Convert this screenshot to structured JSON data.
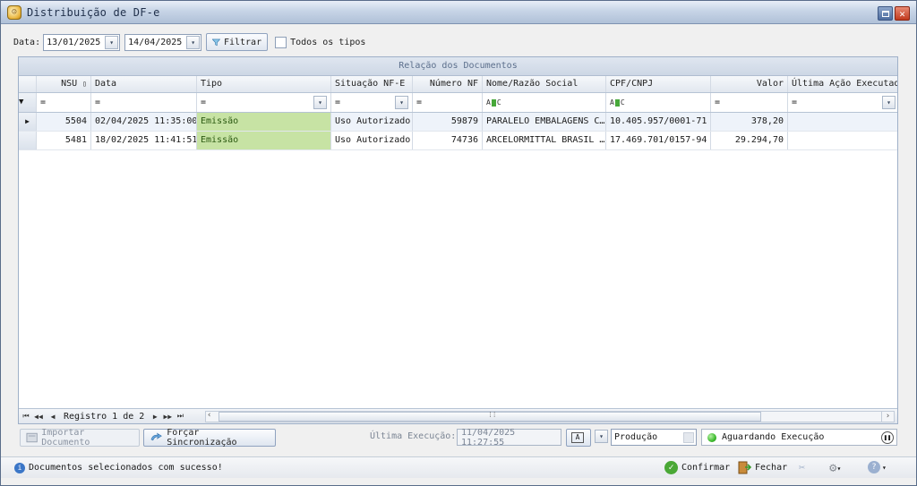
{
  "window": {
    "title": "Distribuição de DF-e"
  },
  "toolbar": {
    "date_label": "Data:",
    "date_from": "13/01/2025",
    "date_to": "14/04/2025",
    "filter_button": "Filtrar",
    "all_types_label": "Todos os tipos"
  },
  "grid": {
    "group_title": "Relação dos Documentos",
    "columns": [
      "NSU",
      "Data",
      "Tipo",
      "Situação NF-E",
      "Número NF",
      "Nome/Razão Social",
      "CPF/CNPJ",
      "Valor",
      "Última Ação Executada"
    ],
    "filters": {
      "nsu": "=",
      "data": "=",
      "tipo": "=",
      "situacao": "=",
      "numero": "=",
      "nome": "ABC",
      "cpf": "ABC",
      "valor": "=",
      "acao": "="
    },
    "rows": [
      {
        "nsu": "5504",
        "data": "02/04/2025 11:35:00",
        "tipo": "Emissão",
        "situacao": "Uso Autorizado",
        "numero": "59879",
        "nome": "PARALELO EMBALAGENS C…",
        "cpf": "10.405.957/0001-71",
        "valor": "378,20",
        "acao": ""
      },
      {
        "nsu": "5481",
        "data": "18/02/2025 11:41:51",
        "tipo": "Emissão",
        "situacao": "Uso Autorizado",
        "numero": "74736",
        "nome": "ARCELORMITTAL BRASIL …",
        "cpf": "17.469.701/0157-94",
        "valor": "29.294,70",
        "acao": ""
      }
    ]
  },
  "navigator": {
    "record_text": "Registro 1 de 2"
  },
  "bottom": {
    "import_button": "Importar Documento",
    "sync_button": "Forçar Sincronização",
    "last_exec_label": "Última Execução:",
    "last_exec_value": "11/04/2025 11:27:55",
    "environment": "Produção",
    "status": "Aguardando Execução"
  },
  "statusbar": {
    "message": "Documentos selecionados com sucesso!",
    "confirm_button": "Confirmar",
    "close_button": "Fechar"
  },
  "colors": {
    "tipo_highlight": "#c7e3a4",
    "title_bar": "#c7d4e6",
    "status_led": "#3dbb2e"
  }
}
